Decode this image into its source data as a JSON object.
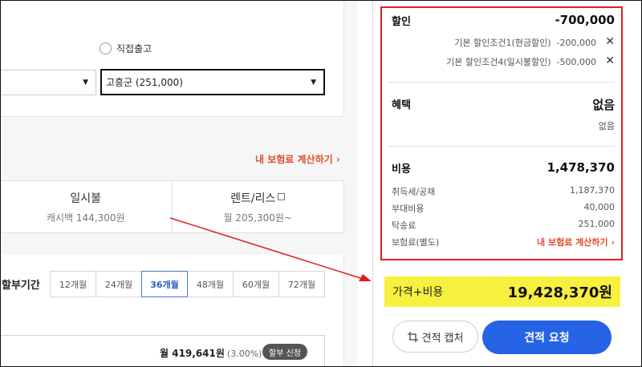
{
  "left": {
    "radio_label": "직접출고",
    "select_1_value": "",
    "select_2_value": "고흥군 (251,000)",
    "calc_link": "내 보험료 계산하기 ›",
    "payment_options": [
      {
        "title": "일시불",
        "sub": "캐시백 144,300원"
      },
      {
        "title": "렌트/리스",
        "sub": "월 205,300원~"
      }
    ],
    "installment_label": "할부기간",
    "installment_tabs": [
      "12개월",
      "24개월",
      "36개월",
      "48개월",
      "60개월",
      "72개월"
    ],
    "installment_active": "36개월",
    "monthly_amount": "월 419,641원",
    "monthly_rate": "(3.00%)",
    "monthly_button": "할부 신청"
  },
  "right": {
    "discount": {
      "title": "할인",
      "value": "-700,000",
      "items": [
        {
          "label": "기본 할인조건1(현금할인)",
          "value": "-200,000"
        },
        {
          "label": "기본 할인조건4(일시불할인)",
          "value": "-500,000"
        }
      ]
    },
    "benefit": {
      "title": "혜택",
      "value": "없음",
      "sub": "없음"
    },
    "cost": {
      "title": "비용",
      "value": "1,478,370",
      "items": [
        {
          "label": "취득세/공채",
          "value": "1,187,370"
        },
        {
          "label": "부대비용",
          "value": "40,000"
        },
        {
          "label": "탁송료",
          "value": "251,000"
        },
        {
          "label": "보험료(별도)",
          "value": "내 보험료 계산하기 ›"
        }
      ]
    },
    "total_label": "가격+비용",
    "total_value": "19,428,370원",
    "capture_button": "견적 캡처",
    "request_button": "견적 요청"
  },
  "colors": {
    "highlight_box": "#e02020",
    "arrow": "#e02020",
    "total_bg": "#f8f03e",
    "primary_button": "#2763e5",
    "link_orange": "#e34c2a",
    "active_tab": "#2b5dc9"
  },
  "icons": {
    "remove": "close-icon",
    "capture": "crop-icon",
    "external": "copy-icon",
    "dropdown": "caret-down-icon"
  }
}
